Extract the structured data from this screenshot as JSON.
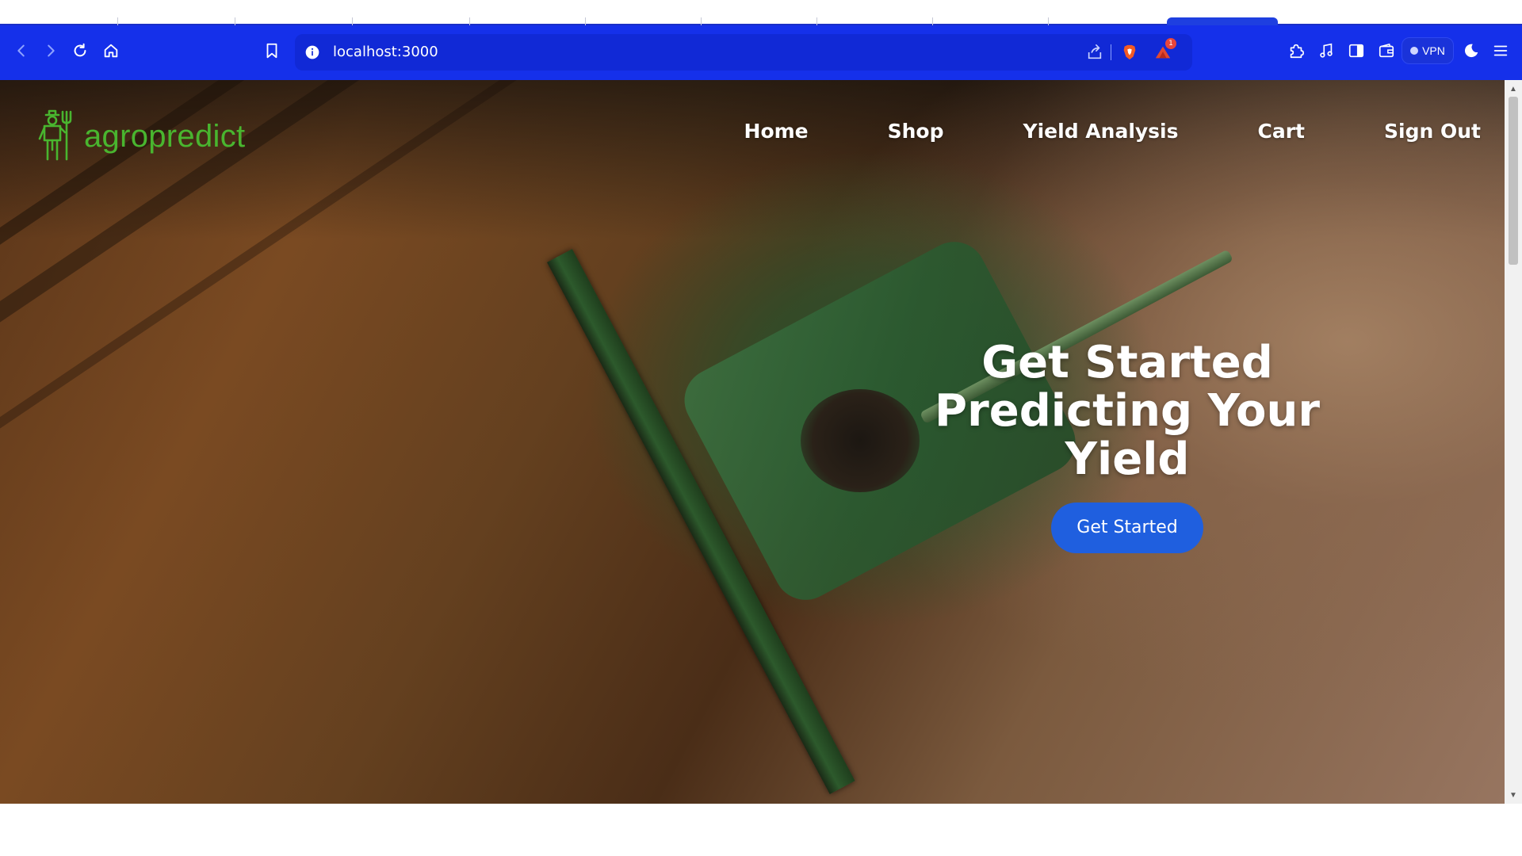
{
  "browser": {
    "url": "localhost:3000",
    "notification_count": "1",
    "vpn_label": "VPN",
    "accent_color": "#1530ea",
    "toolbar_icons": [
      "back-icon",
      "forward-icon",
      "reload-icon",
      "home-icon",
      "bookmark-icon",
      "info-icon",
      "share-icon",
      "brave-shield-icon",
      "brave-rewards-icon",
      "extensions-icon",
      "media-icon",
      "sidebar-icon",
      "wallet-icon",
      "leo-icon",
      "menu-icon"
    ]
  },
  "site": {
    "logo_text": "agropredict",
    "logo_color": "#49b52f",
    "nav": [
      "Home",
      "Shop",
      "Yield Analysis",
      "Cart",
      "Sign Out"
    ],
    "hero": {
      "title": "Get Started Predicting Your Yield",
      "cta_label": "Get Started",
      "cta_color": "#1f5fdf"
    }
  }
}
